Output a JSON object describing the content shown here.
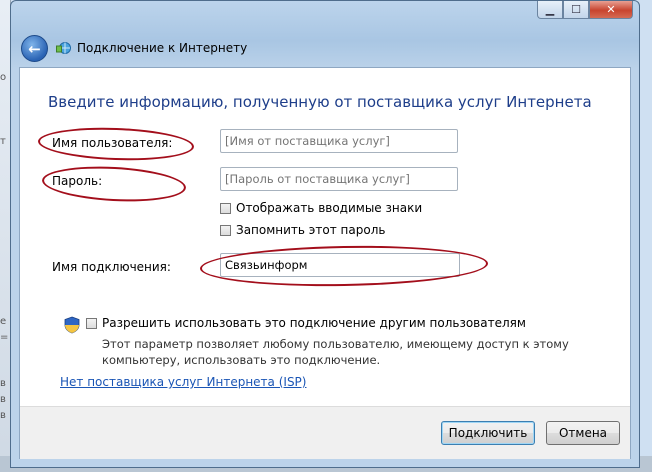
{
  "window": {
    "title": "Подключение к Интернету",
    "controls": {
      "minimize": "▁",
      "maximize": "☐",
      "close": "✕"
    }
  },
  "heading": "Введите информацию, полученную от поставщика услуг Интернета",
  "form": {
    "username_label": "Имя пользователя:",
    "username_placeholder": "[Имя от поставщика услуг]",
    "password_label": "Пароль:",
    "password_placeholder": "[Пароль от поставщика услуг]",
    "show_chars_label": "Отображать вводимые знаки",
    "remember_password_label": "Запомнить этот пароль",
    "connection_name_label": "Имя подключения:",
    "connection_name_value": "Связьинформ",
    "allow_others_label": "Разрешить использовать это подключение другим пользователям",
    "allow_others_description": "Этот параметр позволяет любому пользователю, имеющему доступ к этому компьютеру, использовать это подключение."
  },
  "no_isp_link": "Нет поставщика услуг Интернета (ISP)",
  "buttons": {
    "connect": "Подключить",
    "cancel": "Отмена"
  },
  "background_fragments": [
    "о",
    "т",
    "е",
    "=",
    "в",
    "в",
    "в"
  ],
  "colors": {
    "accent": "#1e3e8a",
    "link": "#1a55b5",
    "annotation": "#a30e1b"
  }
}
